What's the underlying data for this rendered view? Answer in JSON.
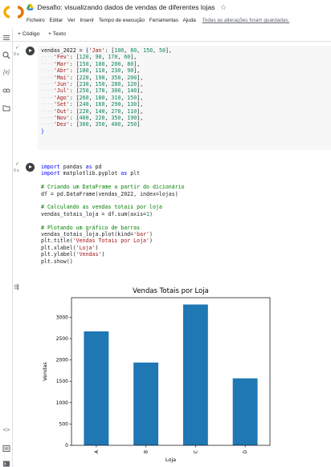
{
  "header": {
    "title": "Desafio: visualizando dados de vendas de diferentes lojas",
    "menu": [
      "Ficheiro",
      "Editar",
      "Ver",
      "Inserir",
      "Tempo de execução",
      "Ferramentas",
      "Ajuda"
    ],
    "saved_status": "Todas as alterações foram guardadas."
  },
  "toolbar": {
    "add_code": "+ Código",
    "add_text": "+ Texto"
  },
  "cell1": {
    "status": "0 s",
    "lines": [
      "vendas_2022 = {'Jan': [100, 80, 150, 50],",
      "    'Fev': [120, 90, 170, 60],",
      "    'Mar': [150, 100, 200, 80],",
      "    'Abr': [180, 110, 230, 90],",
      "    'Mai': [220, 190, 350, 200],",
      "    'Jun': [230, 150, 280, 120],",
      "    'Jul': [250, 170, 300, 140],",
      "    'Ago': [260, 180, 310, 150],",
      "    'Set': [240, 160, 290, 130],",
      "    'Out': [220, 140, 270, 110],",
      "    'Nov': [400, 220, 350, 190],",
      "    'Dez': [300, 350, 400, 250]",
      "}"
    ]
  },
  "cell2": {
    "status": "0 s",
    "lines": [
      "import pandas as pd",
      "import matplotlib.pyplot as plt",
      "",
      "# Criando um DataFrame a partir do dicionário",
      "df = pd.DataFrame(vendas_2022, index=lojas)",
      "",
      "# Calculando as vendas totais por loja",
      "vendas_totais_loja = df.sum(axis=1)",
      "",
      "# Plotando um gráfico de barras",
      "vendas_totais_loja.plot(kind='bar')",
      "plt.title('Vendas Totais por Loja')",
      "plt.xlabel('Loja')",
      "plt.ylabel('Vendas')",
      "plt.show()"
    ]
  },
  "chart_data": {
    "type": "bar",
    "title": "Vendas Totais por Loja",
    "xlabel": "Loja",
    "ylabel": "Vendas",
    "categories": [
      "A",
      "B",
      "C",
      "D"
    ],
    "values": [
      2670,
      1940,
      3300,
      1570
    ],
    "ylim": [
      0,
      3460
    ],
    "yticks": [
      0,
      500,
      1000,
      1500,
      2000,
      2500,
      3000
    ],
    "bar_color": "#1f77b4",
    "grid": false,
    "legend": "none"
  },
  "colors": {
    "accent": "#1a73e8",
    "run_button": "#3c4043",
    "code_bg": "#f7f7f7"
  },
  "icons": {
    "rail": [
      "toc-icon",
      "search-icon",
      "variables-icon",
      "secrets-key-icon",
      "files-folder-icon",
      "code-snippets-icon",
      "command-palette-icon",
      "terminal-icon"
    ]
  }
}
